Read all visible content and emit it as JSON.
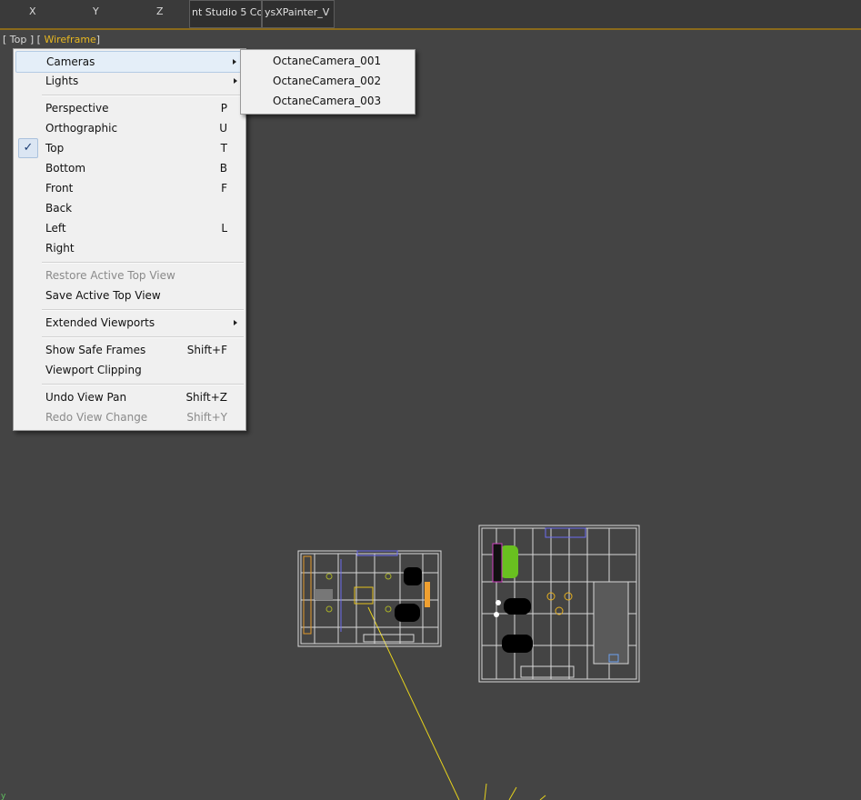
{
  "toolbar": {
    "axes": [
      "X",
      "Y",
      "Z"
    ],
    "tabs": [
      "nt Studio 5 Co",
      "ysXPainter_V"
    ]
  },
  "viewport": {
    "label_open": "[ Top ] [",
    "mode": "Wireframe",
    "label_close": "]",
    "axis_corner": "y"
  },
  "main_menu": {
    "cameras": "Cameras",
    "lights": "Lights",
    "perspective": {
      "label": "Perspective",
      "shortcut": "P"
    },
    "orthographic": {
      "label": "Orthographic",
      "shortcut": "U"
    },
    "top": {
      "label": "Top",
      "shortcut": "T",
      "checked": true
    },
    "bottom": {
      "label": "Bottom",
      "shortcut": "B"
    },
    "front": {
      "label": "Front",
      "shortcut": "F"
    },
    "back": {
      "label": "Back"
    },
    "left": {
      "label": "Left",
      "shortcut": "L"
    },
    "right": {
      "label": "Right"
    },
    "restore_view": "Restore Active Top View",
    "save_view": "Save Active Top View",
    "extended": "Extended Viewports",
    "safe_frames": {
      "label": "Show Safe Frames",
      "shortcut": "Shift+F"
    },
    "clipping": "Viewport Clipping",
    "undo": {
      "label": "Undo View Pan",
      "shortcut": "Shift+Z"
    },
    "redo": {
      "label": "Redo View Change",
      "shortcut": "Shift+Y"
    }
  },
  "cameras_submenu": [
    "OctaneCamera_001",
    "OctaneCamera_002",
    "OctaneCamera_003"
  ],
  "colors": {
    "accent": "#e8b820",
    "viewport_bg": "#444444",
    "menu_bg": "#f0f0f0",
    "highlight": "#e4eef8"
  }
}
